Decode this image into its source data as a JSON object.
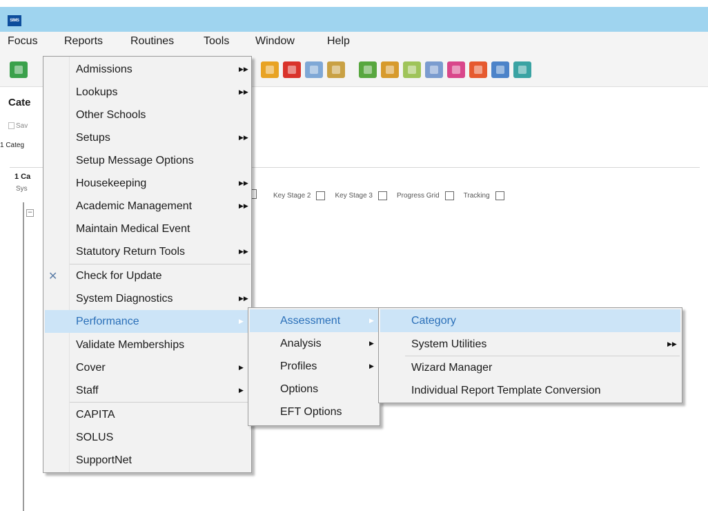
{
  "app": {
    "icon_text": "SIMS"
  },
  "menubar": {
    "items": [
      {
        "label": "Focus"
      },
      {
        "label": "Reports"
      },
      {
        "label": "Routines"
      },
      {
        "label": "Tools"
      },
      {
        "label": "Window"
      },
      {
        "label": "Help"
      }
    ]
  },
  "background": {
    "title": "Cate",
    "save": "Sav",
    "category_count": "1 Categ",
    "panel_heading": "1 Ca",
    "system": "Sys",
    "expander": "−",
    "key_stages": [
      {
        "label": "Key Stage 2",
        "checked": false
      },
      {
        "label": "Key Stage 3",
        "checked": false
      },
      {
        "label": "Progress Grid",
        "checked": false
      },
      {
        "label": "Tracking",
        "checked": false
      }
    ]
  },
  "reports_menu": {
    "items": [
      {
        "label": "Admissions",
        "submenu": true
      },
      {
        "label": "Lookups",
        "submenu": true
      },
      {
        "label": "Other Schools",
        "submenu": false
      },
      {
        "label": "Setups",
        "submenu": true
      },
      {
        "label": "Setup Message Options",
        "submenu": false
      },
      {
        "label": "Housekeeping",
        "submenu": true
      },
      {
        "label": "Academic Management",
        "submenu": true
      },
      {
        "label": "Maintain Medical Event",
        "submenu": false
      },
      {
        "label": "Statutory Return Tools",
        "submenu": true
      },
      {
        "label": "Check for Update",
        "submenu": false,
        "icon": "tools-icon"
      },
      {
        "label": "System Diagnostics",
        "submenu": true
      },
      {
        "label": "Performance",
        "submenu": true,
        "highlighted": true
      },
      {
        "label": "Validate Memberships",
        "submenu": false
      },
      {
        "label": "Cover",
        "submenu": true
      },
      {
        "label": "Staff",
        "submenu": true
      },
      {
        "label": "CAPITA",
        "submenu": false
      },
      {
        "label": "SOLUS",
        "submenu": false
      },
      {
        "label": "SupportNet",
        "submenu": false
      }
    ]
  },
  "performance_menu": {
    "items": [
      {
        "label": "Assessment",
        "submenu": true,
        "highlighted": true
      },
      {
        "label": "Analysis",
        "submenu": true
      },
      {
        "label": "Profiles",
        "submenu": true
      },
      {
        "label": "Options",
        "submenu": false
      },
      {
        "label": "EFT Options",
        "submenu": false
      }
    ]
  },
  "assessment_menu": {
    "items": [
      {
        "label": "Category",
        "submenu": false,
        "highlighted": true
      },
      {
        "label": "System Utilities",
        "submenu": true
      },
      {
        "label": "Wizard Manager",
        "submenu": false
      },
      {
        "label": "Individual Report Template Conversion",
        "submenu": false
      }
    ]
  },
  "colors": {
    "titlebar": "#9fd4ef",
    "highlight_bg": "#cce4f7",
    "highlight_text": "#2a6fb8"
  }
}
